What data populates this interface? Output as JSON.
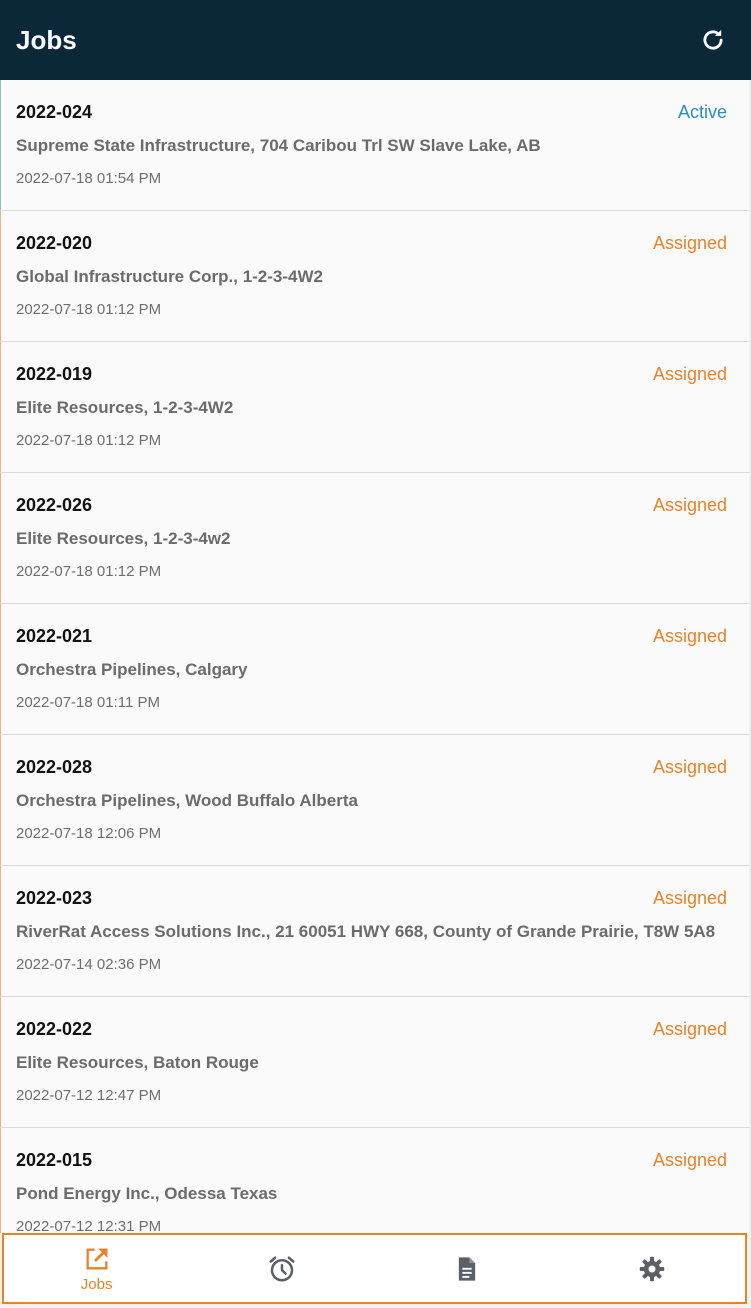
{
  "header": {
    "title": "Jobs",
    "refresh_icon": "refresh-icon"
  },
  "colors": {
    "header_bg": "#0b2838",
    "accent_orange": "#e8832a",
    "active_blue": "#2a8cc4"
  },
  "jobs": [
    {
      "number": "2022-024",
      "status": "Active",
      "client": "Supreme State Infrastructure, 704 Caribou Trl SW Slave Lake, AB",
      "date": "2022-07-18 01:54 PM"
    },
    {
      "number": "2022-020",
      "status": "Assigned",
      "client": "Global Infrastructure Corp., 1-2-3-4W2",
      "date": "2022-07-18 01:12 PM"
    },
    {
      "number": "2022-019",
      "status": "Assigned",
      "client": "Elite Resources, 1-2-3-4W2",
      "date": "2022-07-18 01:12 PM"
    },
    {
      "number": "2022-026",
      "status": "Assigned",
      "client": "Elite Resources, 1-2-3-4w2",
      "date": "2022-07-18 01:12 PM"
    },
    {
      "number": "2022-021",
      "status": "Assigned",
      "client": "Orchestra Pipelines, Calgary",
      "date": "2022-07-18 01:11 PM"
    },
    {
      "number": "2022-028",
      "status": "Assigned",
      "client": "Orchestra Pipelines, Wood Buffalo Alberta",
      "date": "2022-07-18 12:06 PM"
    },
    {
      "number": "2022-023",
      "status": "Assigned",
      "client": "RiverRat Access Solutions Inc., 21 60051 HWY 668, County of Grande Prairie, T8W 5A8",
      "date": "2022-07-14 02:36 PM"
    },
    {
      "number": "2022-022",
      "status": "Assigned",
      "client": "Elite Resources, Baton Rouge",
      "date": "2022-07-12 12:47 PM"
    },
    {
      "number": "2022-015",
      "status": "Assigned",
      "client": "Pond Energy Inc., Odessa Texas",
      "date": "2022-07-12 12:31 PM"
    }
  ],
  "bottom_nav": {
    "items": [
      {
        "label": "Jobs",
        "icon": "open-in-new-icon",
        "selected": true
      },
      {
        "label": "",
        "icon": "alarm-clock-icon",
        "selected": false
      },
      {
        "label": "",
        "icon": "document-icon",
        "selected": false
      },
      {
        "label": "",
        "icon": "gear-icon",
        "selected": false
      }
    ]
  }
}
